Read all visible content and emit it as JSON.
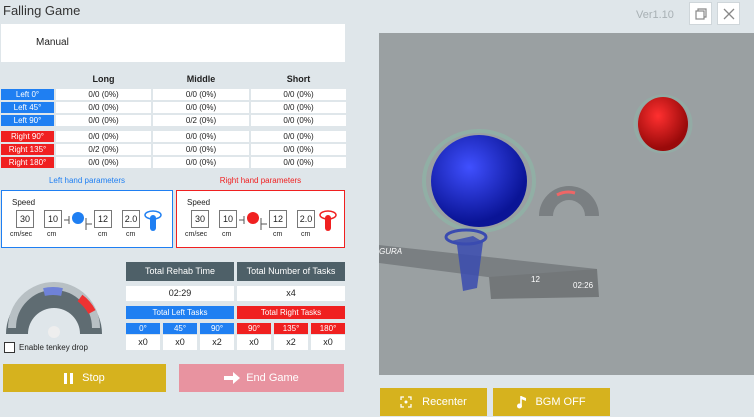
{
  "app": {
    "title": "Falling Game",
    "version": "Ver1.10"
  },
  "mode": "Manual",
  "distance_columns": [
    "Long",
    "Middle",
    "Short"
  ],
  "left_rows": [
    {
      "label": "Left 0°",
      "values": [
        "0/0 (0%)",
        "0/0 (0%)",
        "0/0 (0%)"
      ]
    },
    {
      "label": "Left 45°",
      "values": [
        "0/0 (0%)",
        "0/0 (0%)",
        "0/0 (0%)"
      ]
    },
    {
      "label": "Left 90°",
      "values": [
        "0/0 (0%)",
        "0/2 (0%)",
        "0/0 (0%)"
      ]
    }
  ],
  "right_rows": [
    {
      "label": "Right 90°",
      "values": [
        "0/0 (0%)",
        "0/0 (0%)",
        "0/0 (0%)"
      ]
    },
    {
      "label": "Right 135°",
      "values": [
        "0/2 (0%)",
        "0/0 (0%)",
        "0/0 (0%)"
      ]
    },
    {
      "label": "Right 180°",
      "values": [
        "0/0 (0%)",
        "0/0 (0%)",
        "0/0 (0%)"
      ]
    }
  ],
  "left_params": {
    "title": "Left hand parameters",
    "speed_label": "Speed",
    "speed": "30",
    "speed_unit": "cm/sec",
    "a": "10",
    "a_unit": "cm",
    "b": "12",
    "b_unit": "cm",
    "c": "2.0",
    "c_unit": "cm"
  },
  "right_params": {
    "title": "Right hand parameters",
    "speed_label": "Speed",
    "speed": "30",
    "speed_unit": "cm/sec",
    "a": "10",
    "a_unit": "cm",
    "b": "12",
    "b_unit": "cm",
    "c": "2.0",
    "c_unit": "cm"
  },
  "stats": {
    "rehab_time_label": "Total Rehab Time",
    "rehab_time": "02:29",
    "tasks_label": "Total Number of Tasks",
    "tasks": "x4",
    "left_tasks_label": "Total Left Tasks",
    "right_tasks_label": "Total Right Tasks",
    "left_angles": [
      "0°",
      "45°",
      "90°"
    ],
    "left_counts": [
      "x0",
      "x0",
      "x2"
    ],
    "right_angles": [
      "90°",
      "135°",
      "180°"
    ],
    "right_counts": [
      "x0",
      "x2",
      "x0"
    ]
  },
  "tenkey_label": "Enable tenkey drop",
  "buttons": {
    "stop": "Stop",
    "end_game": "End Game",
    "recenter": "Recenter",
    "bgm": "BGM OFF"
  },
  "hud": {
    "brand": "GURA",
    "count": "12",
    "time": "02:26"
  },
  "colors": {
    "blue": "#1f7ff2",
    "red": "#f02020",
    "gold": "#d6b21e",
    "pink": "#e893a0",
    "dark_header": "#4e6068"
  }
}
